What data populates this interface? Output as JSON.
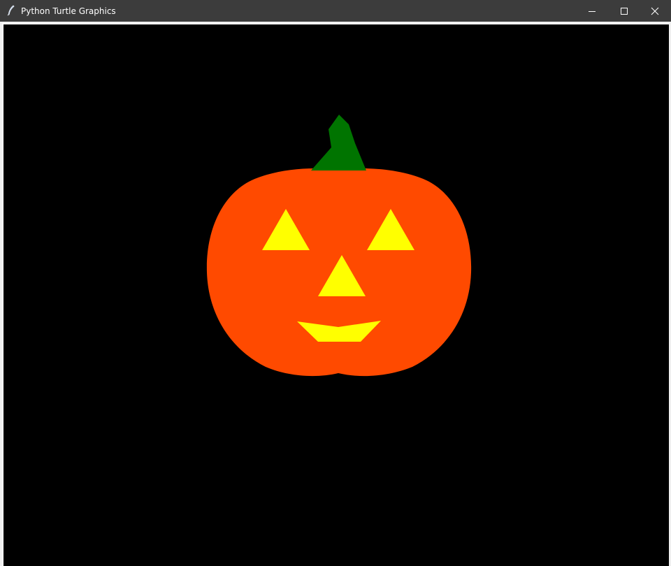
{
  "window": {
    "title": "Python Turtle Graphics",
    "controls": [
      {
        "name": "minimize",
        "icon": "minimize-icon"
      },
      {
        "name": "maximize",
        "icon": "maximize-icon"
      },
      {
        "name": "close",
        "icon": "close-icon"
      }
    ]
  },
  "canvas": {
    "background": "#000000",
    "drawing": "jack-o-lantern",
    "colors": {
      "pumpkin": "#ff4a00",
      "stem": "#007400",
      "face": "#ffff00"
    }
  }
}
